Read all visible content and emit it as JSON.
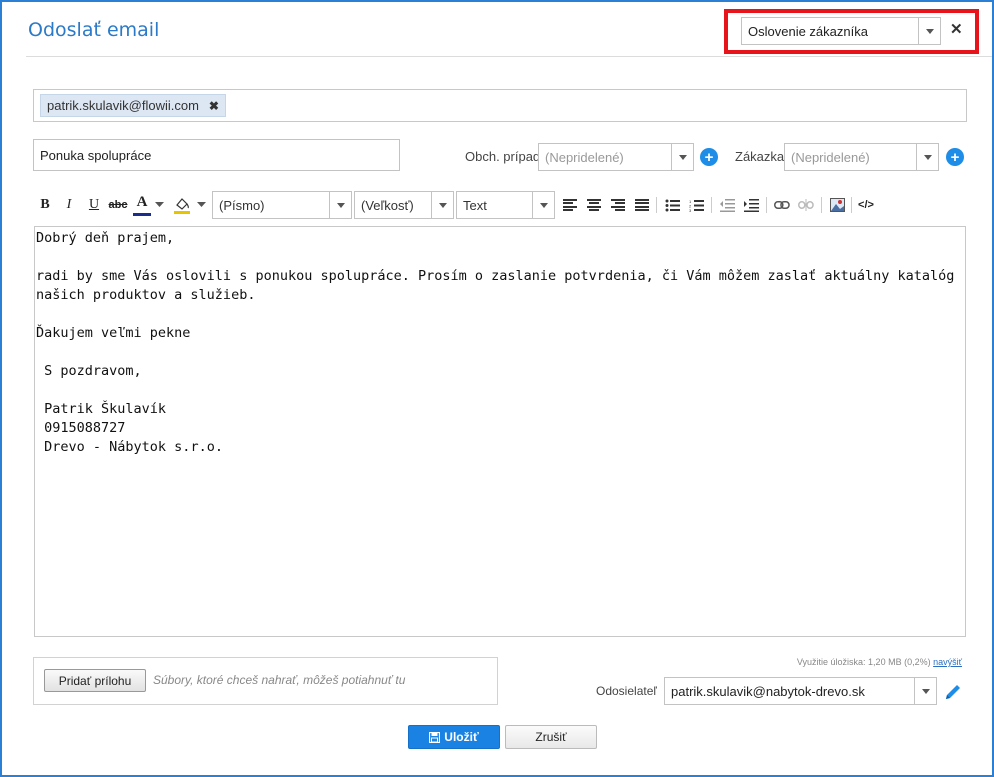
{
  "dialog": {
    "title": "Odoslať email",
    "template_select": "Oslovenie zákazníka",
    "close_glyph": "✕"
  },
  "recipients": [
    {
      "email": "patrik.skulavik@flowii.com",
      "remove_glyph": "✖"
    }
  ],
  "subject": "Ponuka spolupráce",
  "business_case": {
    "label": "Obch. prípad",
    "value": "(Nepridelené)"
  },
  "order": {
    "label": "Zákazka",
    "value": "(Nepridelené)"
  },
  "toolbar": {
    "bold": "B",
    "italic": "I",
    "underline": "U",
    "strike": "abc",
    "font_color": "A",
    "font": "(Písmo)",
    "size": "(Veľkosť)",
    "format": "Text",
    "html_source": "</>"
  },
  "body_lines": [
    "Dobrý deň prajem,",
    "",
    "radi by sme Vás oslovili s ponukou spolupráce. Prosím o zaslanie potvrdenia, či Vám môžem zaslať aktuálny katalóg našich produktov a služieb.",
    "",
    "Ďakujem veľmi pekne",
    "",
    " S pozdravom,",
    "",
    " Patrik Škulavík",
    " 0915088727",
    " Drevo - Nábytok s.r.o."
  ],
  "attachment": {
    "button_label": "Pridať prílohu",
    "hint": "Súbory, ktoré chceš nahrať, môžeš potiahnuť tu"
  },
  "storage": {
    "text": "Využitie úložiska: 1,20 MB (0,2%)",
    "link": "navýšiť"
  },
  "sender": {
    "label": "Odosielateľ",
    "value": "patrik.skulavik@nabytok-drevo.sk"
  },
  "actions": {
    "save": "Uložiť",
    "cancel": "Zrušiť"
  },
  "colors": {
    "accent": "#1a82e2",
    "highlight_box": "#e8141b",
    "title": "#2a7ac9"
  }
}
